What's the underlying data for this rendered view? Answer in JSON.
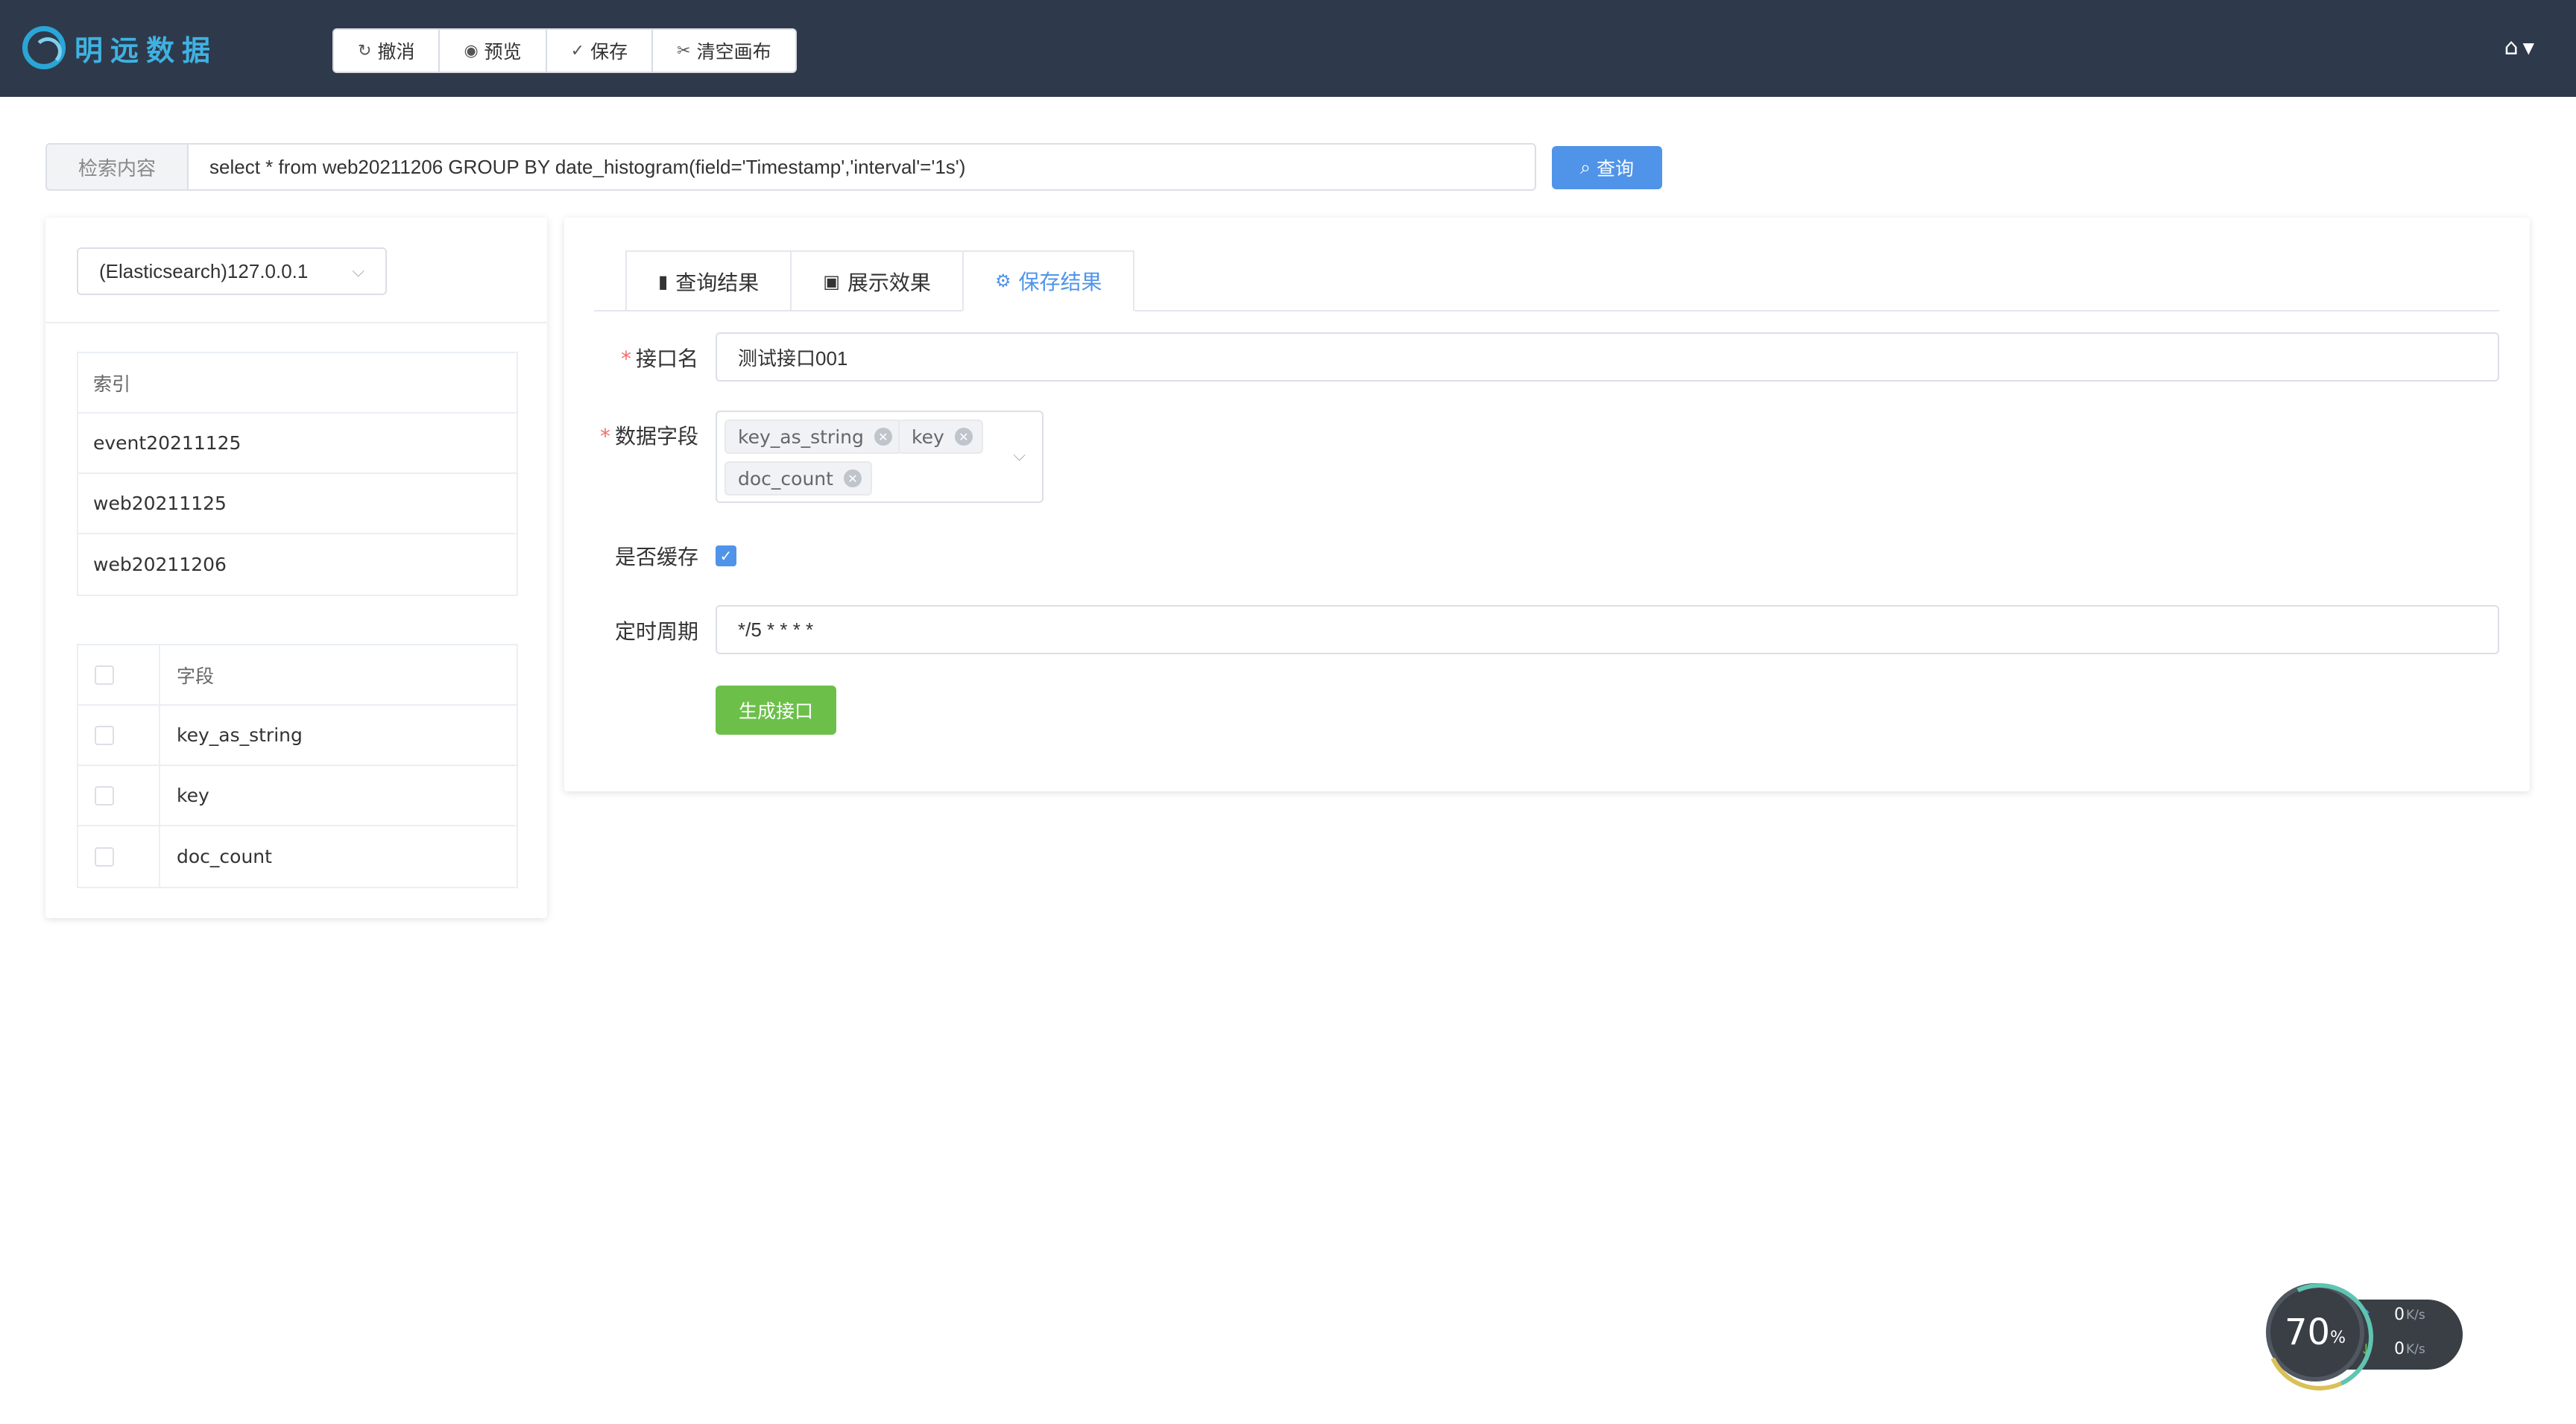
{
  "header": {
    "logo_text": "明远数据",
    "toolbar": [
      {
        "icon": "undo-icon",
        "label": "撤消"
      },
      {
        "icon": "eye-icon",
        "label": "预览"
      },
      {
        "icon": "save-icon",
        "label": "保存"
      },
      {
        "icon": "scissors-icon",
        "label": "清空画布"
      }
    ]
  },
  "search": {
    "label": "检索内容",
    "value": "select * from web20211206 GROUP BY date_histogram(field='Timestamp','interval'='1s')",
    "button_label": "查询"
  },
  "left": {
    "datasource": "(Elasticsearch)127.0.0.1",
    "index_header": "索引",
    "indices": [
      "event20211125",
      "web20211125",
      "web20211206"
    ],
    "field_header": "字段",
    "fields": [
      "key_as_string",
      "key",
      "doc_count"
    ]
  },
  "right": {
    "tabs": [
      {
        "icon": "bar-chart-icon",
        "label": "查询结果",
        "active": false
      },
      {
        "icon": "image-icon",
        "label": "展示效果",
        "active": false
      },
      {
        "icon": "gear-icon",
        "label": "保存结果",
        "active": true
      }
    ],
    "form": {
      "api_name_label": "接口名",
      "api_name_value": "测试接口001",
      "data_fields_label": "数据字段",
      "data_fields_tags": [
        "key_as_string",
        "key",
        "doc_count"
      ],
      "cache_label": "是否缓存",
      "cache_checked": true,
      "schedule_label": "定时周期",
      "schedule_value": "*/5 * * * *",
      "generate_button": "生成接口"
    }
  },
  "speed_widget": {
    "percent": "70",
    "percent_unit": "%",
    "up_value": "0",
    "down_value": "0",
    "unit": "K/s"
  },
  "colors": {
    "header_bg": "#2e3a4b",
    "primary": "#4f94e8",
    "success": "#6cc04a",
    "required": "#f56c6c"
  }
}
